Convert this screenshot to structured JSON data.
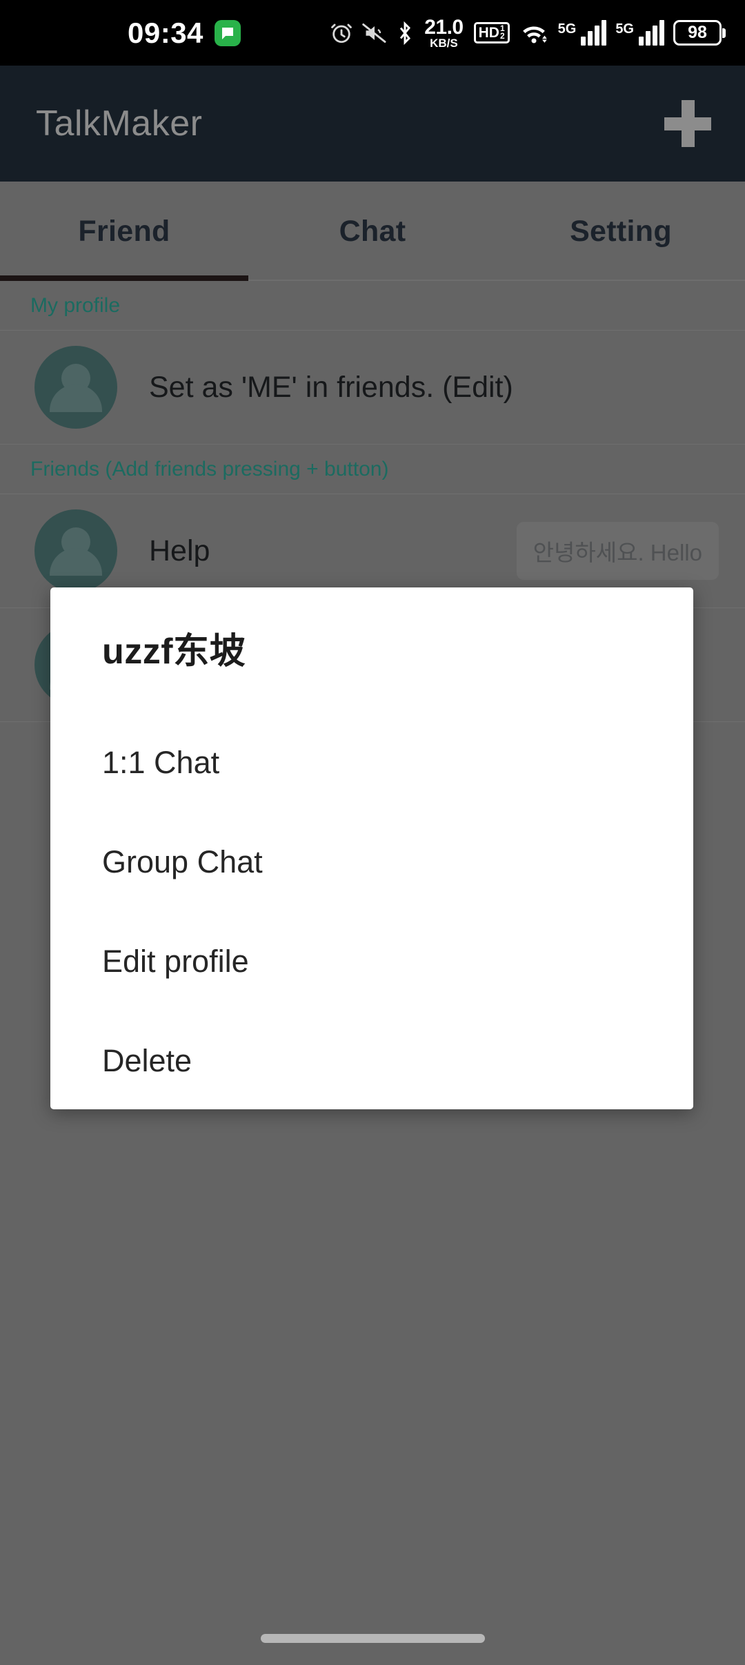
{
  "status_bar": {
    "time": "09:34",
    "app_notification_icon": "message-bubble-icon",
    "icons": [
      "alarm-icon",
      "mute-icon",
      "bluetooth-icon",
      "network-speed",
      "hd-voice-icon",
      "wifi-icon",
      "signal-sim1-icon",
      "signal-sim2-icon",
      "battery-icon"
    ],
    "network_speed_value": "21.0",
    "network_speed_unit": "KB/S",
    "hd_label": "HD",
    "hd_sup": "1",
    "hd_sub": "2",
    "sim1_network": "5G",
    "sim2_network": "5G",
    "battery_percent": "98"
  },
  "app_bar": {
    "title": "TalkMaker",
    "add_button_label": "+",
    "add_button_name": "plus-icon",
    "background_color": "#161e26",
    "title_color": "#8c8c8c"
  },
  "tabs": {
    "items": [
      {
        "label": "Friend",
        "selected": true
      },
      {
        "label": "Chat",
        "selected": false
      },
      {
        "label": "Setting",
        "selected": false
      }
    ],
    "indicator_color": "#1c1414",
    "text_color": "#1b222b"
  },
  "content": {
    "sections": [
      {
        "header": "My profile",
        "rows": [
          {
            "name": "Set as 'ME' in friends. (Edit)",
            "message": ""
          }
        ]
      },
      {
        "header": "Friends (Add friends pressing + button)",
        "rows": [
          {
            "name": "Help",
            "message": "안녕하세요. Hello"
          },
          {
            "name": "",
            "message": ""
          }
        ]
      }
    ],
    "section_header_color": "#1b6b60",
    "avatar_color": "#34504f"
  },
  "dialog": {
    "title": "uzzf东坡",
    "menu_items": [
      {
        "label": "1:1 Chat"
      },
      {
        "label": "Group Chat"
      },
      {
        "label": "Edit profile"
      },
      {
        "label": "Delete"
      }
    ],
    "background_color": "#ffffff",
    "title_color": "#1c1c1c",
    "item_color": "#262626"
  },
  "nav_bar": {
    "gesture_pill": "home-gesture-pill"
  }
}
